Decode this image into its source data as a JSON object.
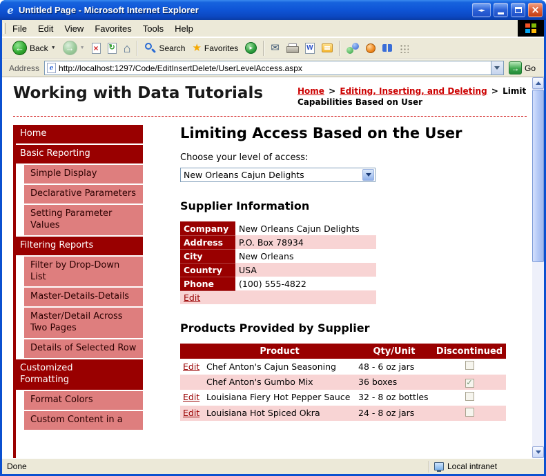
{
  "titlebar": {
    "title": "Untitled Page - Microsoft Internet Explorer"
  },
  "menubar": {
    "items": [
      "File",
      "Edit",
      "View",
      "Favorites",
      "Tools",
      "Help"
    ]
  },
  "toolbar": {
    "back_label": "Back",
    "search_label": "Search",
    "favorites_label": "Favorites"
  },
  "addressbar": {
    "label": "Address",
    "url": "http://localhost:1297/Code/EditInsertDelete/UserLevelAccess.aspx",
    "go_label": "Go"
  },
  "page_header": {
    "site_title": "Working with Data Tutorials",
    "crumb_home": "Home",
    "crumb_sep1": ">",
    "crumb_section": "Editing, Inserting, and Deleting",
    "crumb_sep2": ">",
    "crumb_current": "Limit Capabilities Based on User"
  },
  "sidebar": {
    "items": [
      {
        "label": "Home",
        "type": "section"
      },
      {
        "label": "Basic Reporting",
        "type": "section"
      },
      {
        "label": "Simple Display",
        "type": "sub"
      },
      {
        "label": "Declarative Parameters",
        "type": "sub"
      },
      {
        "label": "Setting Parameter Values",
        "type": "sub"
      },
      {
        "label": "Filtering Reports",
        "type": "section"
      },
      {
        "label": "Filter by Drop-Down List",
        "type": "sub"
      },
      {
        "label": "Master-Details-Details",
        "type": "sub"
      },
      {
        "label": "Master/Detail Across Two Pages",
        "type": "sub"
      },
      {
        "label": "Details of Selected Row",
        "type": "sub"
      },
      {
        "label": "Customized Formatting",
        "type": "section"
      },
      {
        "label": "Format Colors",
        "type": "sub"
      },
      {
        "label": "Custom Content in a",
        "type": "sub"
      }
    ]
  },
  "main": {
    "title": "Limiting Access Based on the User",
    "access_label": "Choose your level of access:",
    "access_value": "New Orleans Cajun Delights",
    "supplier_heading": "Supplier Information",
    "supplier_rows": [
      {
        "label": "Company",
        "value": "New Orleans Cajun Delights"
      },
      {
        "label": "Address",
        "value": "P.O. Box 78934"
      },
      {
        "label": "City",
        "value": "New Orleans"
      },
      {
        "label": "Country",
        "value": "USA"
      },
      {
        "label": "Phone",
        "value": "(100) 555-4822"
      }
    ],
    "supplier_edit_label": "Edit",
    "products_heading": "Products Provided by Supplier",
    "products_headers": {
      "product": "Product",
      "qty": "Qty/Unit",
      "discontinued": "Discontinued"
    },
    "products_rows": [
      {
        "edit": "Edit",
        "product": "Chef Anton's Cajun Seasoning",
        "qty": "48 - 6 oz jars",
        "discontinued": false
      },
      {
        "edit": "",
        "product": "Chef Anton's Gumbo Mix",
        "qty": "36 boxes",
        "discontinued": true
      },
      {
        "edit": "Edit",
        "product": "Louisiana Fiery Hot Pepper Sauce",
        "qty": "32 - 8 oz bottles",
        "discontinued": false
      },
      {
        "edit": "Edit",
        "product": "Louisiana Hot Spiced Okra",
        "qty": "24 - 8 oz jars",
        "discontinued": false
      }
    ]
  },
  "statusbar": {
    "done": "Done",
    "zone": "Local intranet"
  },
  "glyphs": {
    "ie": "e",
    "window_arrows": "◄►",
    "close": "×",
    "caret": "▼",
    "back_arrow": "←",
    "forward_arrow": "→",
    "refresh": "↻",
    "home": "⌂",
    "star": "★",
    "play": "▸",
    "mail": "✉",
    "word": "W",
    "go_arrow": "→",
    "check": "✓"
  },
  "colors": {
    "title_blue": "#0B50D0",
    "dark_red": "#990000",
    "sub_item_red": "#DE7E7E",
    "row_pink": "#F8D4D4",
    "link_red": "#CC0000",
    "chrome_tan": "#ECE9D8"
  }
}
